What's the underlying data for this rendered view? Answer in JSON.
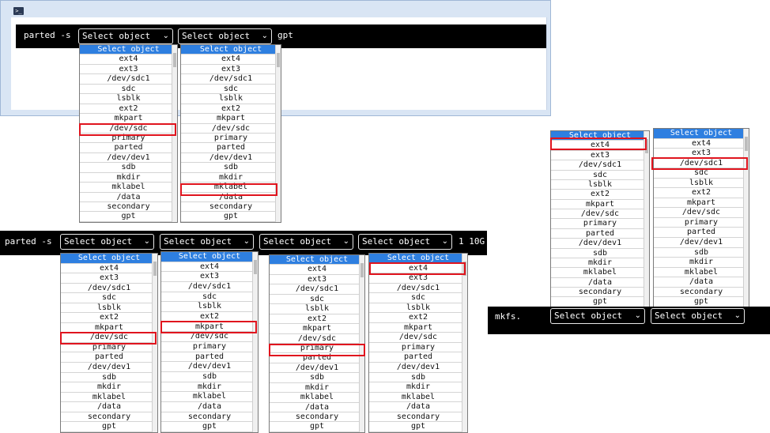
{
  "options": [
    "Select object",
    "ext4",
    "ext3",
    "/dev/sdc1",
    "sdc",
    "lsblk",
    "ext2",
    "mkpart",
    "/dev/sdc",
    "primary",
    "parted",
    "/dev/dev1",
    "sdb",
    "mkdir",
    "mklabel",
    "/data",
    "secondary",
    "gpt"
  ],
  "panel1": {
    "command": "parted -s",
    "trailing": "gpt",
    "select1": "Select object",
    "select2": "Select object",
    "highlight1": "/dev/sdc",
    "highlight2": "mklabel"
  },
  "panel2": {
    "command": "parted -s",
    "trailing": "1 10G",
    "selects": [
      "Select object",
      "Select object",
      "Select object",
      "Select object"
    ],
    "highlights": [
      "/dev/sdc",
      "mkpart",
      "primary",
      "ext4"
    ]
  },
  "panel3": {
    "command": "mkfs.",
    "selects": [
      "Select object",
      "Select object"
    ],
    "highlights": [
      "ext4",
      "/dev/sdc1"
    ]
  },
  "icons": {
    "terminal": "terminal-icon",
    "dropdown": "chevron-down-icon"
  },
  "colors": {
    "highlight": "#e0141e",
    "selected_option": "#2e7fe0",
    "terminal_bg": "#000000"
  }
}
